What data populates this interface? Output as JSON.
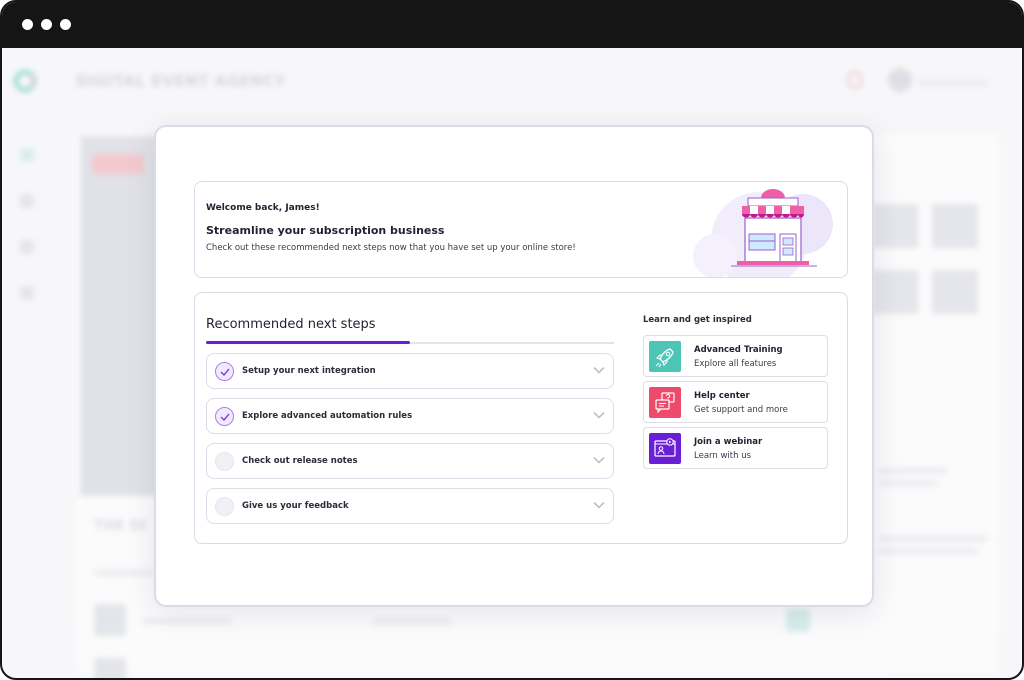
{
  "background_app": {
    "title": "DIGITAL EVENT AGENCY",
    "heading": "THE DI"
  },
  "welcome": {
    "greeting": "Welcome back, James!",
    "title": "Streamline your subscription business",
    "subtitle": "Check out these recommended next steps now that you have set up your online store!"
  },
  "steps": {
    "title": "Recommended next steps",
    "progress_fraction": 0.5,
    "items": [
      {
        "label": "Setup your next integration",
        "completed": true
      },
      {
        "label": "Explore advanced automation rules",
        "completed": true
      },
      {
        "label": "Check out release notes",
        "completed": false
      },
      {
        "label": "Give us your feedback",
        "completed": false
      }
    ]
  },
  "learn": {
    "title": "Learn and get inspired",
    "items": [
      {
        "title": "Advanced Training",
        "subtitle": "Explore all features",
        "icon": "rocket-icon",
        "color": "#4cc4b6"
      },
      {
        "title": "Help center",
        "subtitle": "Get support and more",
        "icon": "chat-question-icon",
        "color": "#ee4a6c"
      },
      {
        "title": "Join a webinar",
        "subtitle": "Learn with us",
        "icon": "video-presentation-icon",
        "color": "#6a1fd6"
      }
    ]
  },
  "colors": {
    "accent": "#6a1fd6",
    "teal": "#4cc4b6",
    "pink": "#ee4a6c"
  }
}
